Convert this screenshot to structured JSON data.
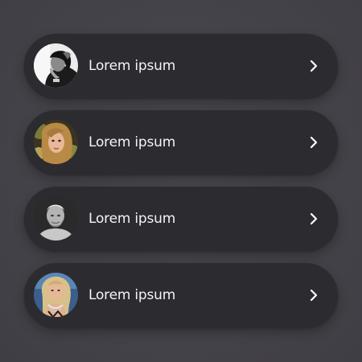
{
  "list": {
    "items": [
      {
        "label": "Lorem ipsum",
        "avatar_icon": "portrait-bw-woman-hand-on-head",
        "chevron_icon": "chevron-right-icon"
      },
      {
        "label": "Lorem ipsum",
        "avatar_icon": "portrait-woman-blonde-curly-hair",
        "chevron_icon": "chevron-right-icon"
      },
      {
        "label": "Lorem ipsum",
        "avatar_icon": "portrait-bw-elderly-man",
        "chevron_icon": "chevron-right-icon"
      },
      {
        "label": "Lorem ipsum",
        "avatar_icon": "portrait-woman-blonde-necklace",
        "chevron_icon": "chevron-right-icon"
      }
    ]
  },
  "colors": {
    "background": "#444349",
    "card": "#2c2b30",
    "text": "#f4f4f6"
  }
}
